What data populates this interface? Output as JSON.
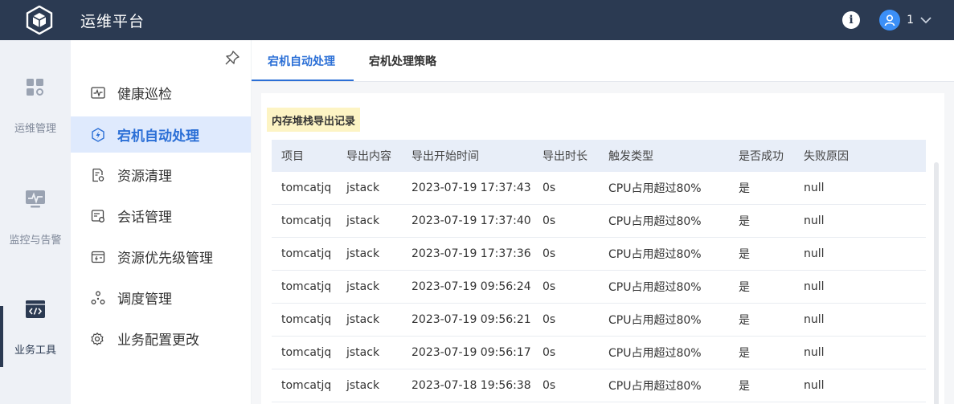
{
  "app": {
    "title": "运维平台"
  },
  "header": {
    "user_name": "1"
  },
  "rail": {
    "items": [
      {
        "label": "运维管理"
      },
      {
        "label": "监控与告警"
      },
      {
        "label": "业务工具"
      }
    ]
  },
  "subnav": {
    "items": [
      {
        "label": "健康巡检"
      },
      {
        "label": "宕机自动处理"
      },
      {
        "label": "资源清理"
      },
      {
        "label": "会话管理"
      },
      {
        "label": "资源优先级管理"
      },
      {
        "label": "调度管理"
      },
      {
        "label": "业务配置更改"
      }
    ]
  },
  "tabs": [
    {
      "label": "宕机自动处理"
    },
    {
      "label": "宕机处理策略"
    }
  ],
  "section": {
    "title": "内存堆栈导出记录"
  },
  "table": {
    "headers": [
      "项目",
      "导出内容",
      "导出开始时间",
      "导出时长",
      "触发类型",
      "是否成功",
      "失败原因"
    ],
    "rows": [
      [
        "tomcatjq",
        "jstack",
        "2023-07-19 17:37:43",
        "0s",
        "CPU占用超过80%",
        "是",
        "null"
      ],
      [
        "tomcatjq",
        "jstack",
        "2023-07-19 17:37:40",
        "0s",
        "CPU占用超过80%",
        "是",
        "null"
      ],
      [
        "tomcatjq",
        "jstack",
        "2023-07-19 17:37:36",
        "0s",
        "CPU占用超过80%",
        "是",
        "null"
      ],
      [
        "tomcatjq",
        "jstack",
        "2023-07-19 09:56:24",
        "0s",
        "CPU占用超过80%",
        "是",
        "null"
      ],
      [
        "tomcatjq",
        "jstack",
        "2023-07-19 09:56:21",
        "0s",
        "CPU占用超过80%",
        "是",
        "null"
      ],
      [
        "tomcatjq",
        "jstack",
        "2023-07-19 09:56:17",
        "0s",
        "CPU占用超过80%",
        "是",
        "null"
      ],
      [
        "tomcatjq",
        "jstack",
        "2023-07-18 19:56:38",
        "0s",
        "CPU占用超过80%",
        "是",
        "null"
      ]
    ]
  },
  "colors": {
    "header_bg": "#2b3a52",
    "accent": "#2b6fd6",
    "active_nav_bg": "#dfeafd",
    "section_highlight": "#fdf4c4"
  },
  "icons": {
    "logo": "cube-logo-icon",
    "info": "info-icon",
    "avatar": "user-avatar-icon",
    "user_menu": "chevron-down-icon",
    "pin": "pin-icon"
  }
}
